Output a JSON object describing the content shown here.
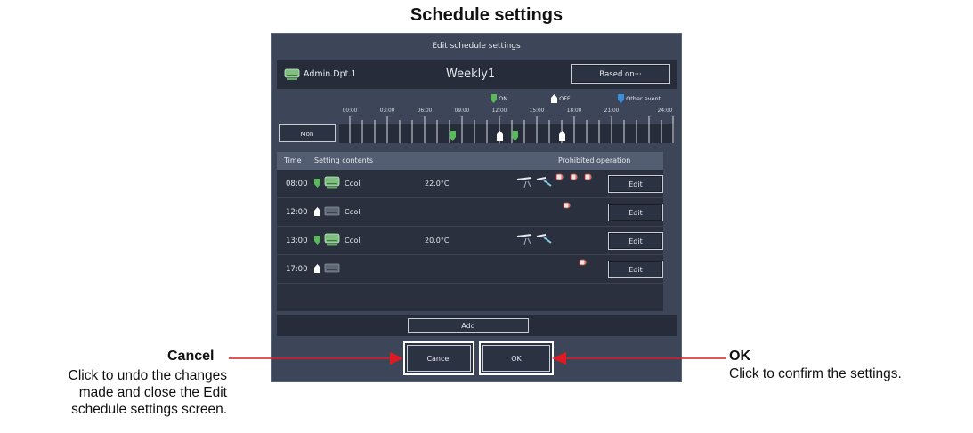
{
  "page_title": "Schedule settings",
  "dialog": {
    "title": "Edit schedule settings",
    "group_name": "Admin.Dpt.1",
    "pattern_name": "Weekly1",
    "based_on_label": "Based on···",
    "legend": {
      "on": "ON",
      "off": "OFF",
      "other": "Other event"
    },
    "timeline": {
      "hours": [
        "00:00",
        "03:00",
        "06:00",
        "09:00",
        "12:00",
        "15:00",
        "18:00",
        "21:00",
        "24:00"
      ],
      "day_label": "Mon"
    },
    "table": {
      "headers": {
        "time": "Time",
        "contents": "Setting contents",
        "prohibited": "Prohibited operation"
      },
      "rows": [
        {
          "time": "08:00",
          "state": "on",
          "mode": "Cool",
          "temp": "22.0°C",
          "edit": "Edit"
        },
        {
          "time": "12:00",
          "state": "off",
          "mode": "Cool",
          "temp": "",
          "edit": "Edit"
        },
        {
          "time": "13:00",
          "state": "on",
          "mode": "Cool",
          "temp": "20.0°C",
          "edit": "Edit"
        },
        {
          "time": "17:00",
          "state": "off",
          "mode": "",
          "temp": "",
          "edit": "Edit"
        }
      ]
    },
    "add_label": "Add",
    "cancel_label": "Cancel",
    "ok_label": "OK"
  },
  "callouts": {
    "cancel": {
      "title": "Cancel",
      "lines": [
        "Click to undo the changes",
        "made and close the Edit",
        "schedule settings screen."
      ]
    },
    "ok": {
      "title": "OK",
      "text": "Click to confirm the settings."
    }
  },
  "colors": {
    "panel": "#3d4658",
    "bar": "#262c3a",
    "on_marker": "#5cb85c",
    "off_marker": "#ffffff",
    "other_marker": "#3a8fd6",
    "callout_arrow": "#e11a22"
  }
}
